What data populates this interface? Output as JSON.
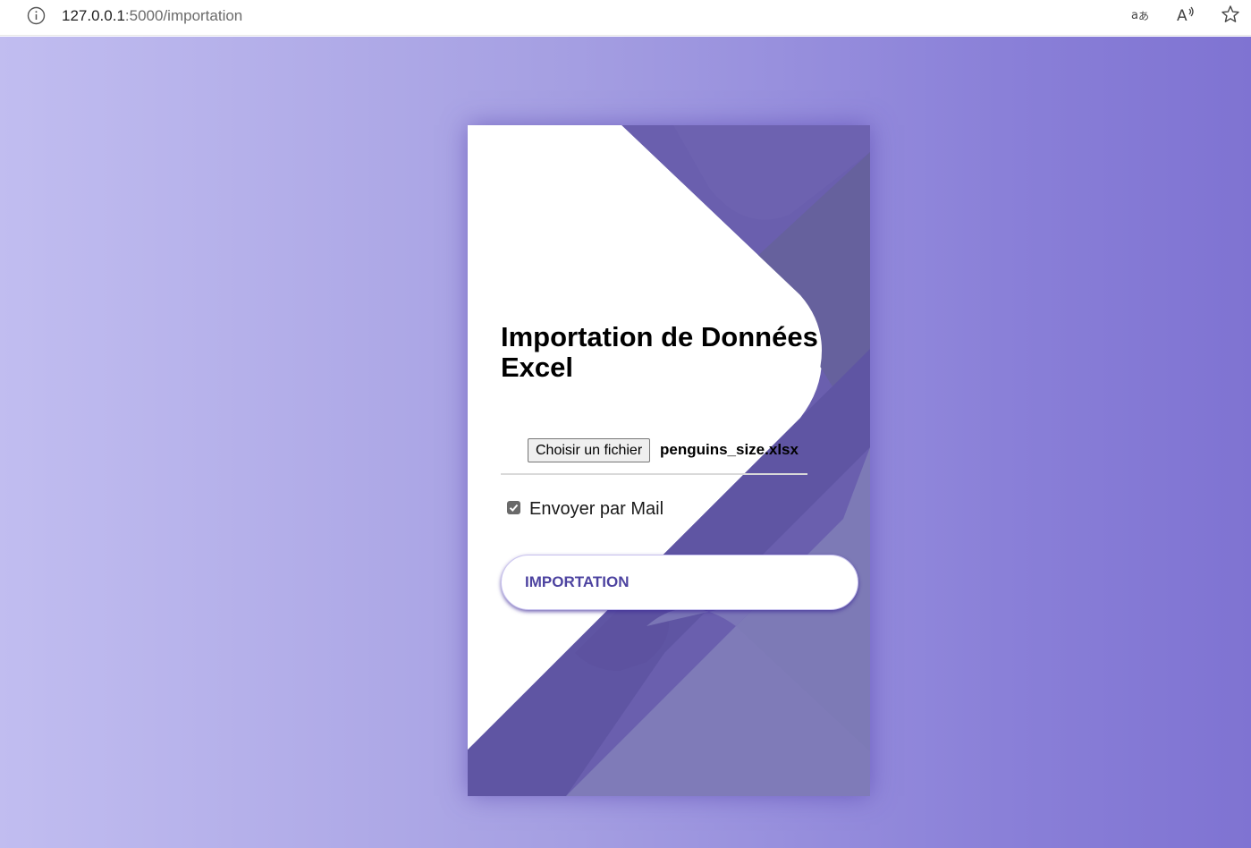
{
  "browser": {
    "url_host": "127.0.0.1",
    "url_rest": ":5000/importation",
    "icons": [
      "info-icon",
      "translate-icon",
      "read-aloud-icon",
      "favorite-star-icon"
    ]
  },
  "form": {
    "title": "Importation de Données Excel",
    "file_button_label": "Choisir un fichier",
    "file_name": "penguins_size.xlsx",
    "mail_label": "Envoyer par Mail",
    "mail_checked": true,
    "submit_label": "IMPORTATION"
  },
  "colors": {
    "accent": "#5d54a4",
    "background_left": "#c1bdf0",
    "background_right": "#7f73d2"
  }
}
